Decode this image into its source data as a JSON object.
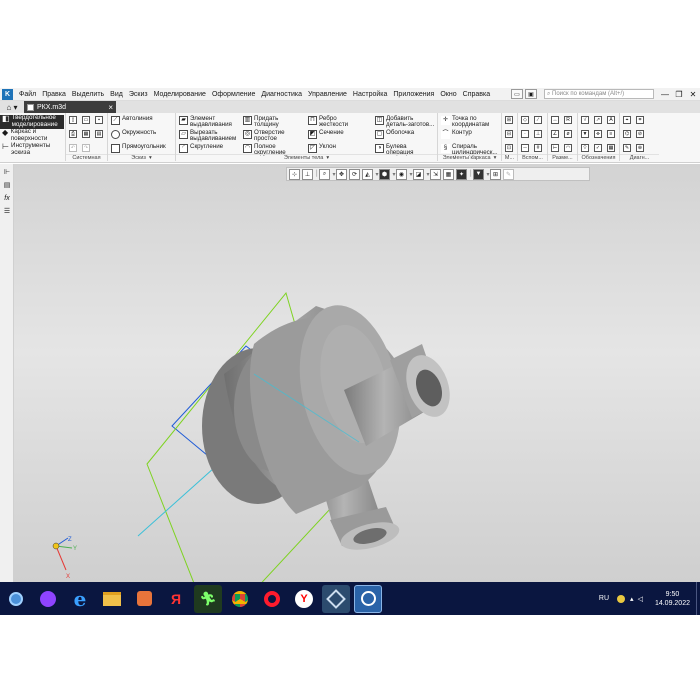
{
  "menubar": {
    "logo": "K",
    "items": [
      "Файл",
      "Правка",
      "Выделить",
      "Вид",
      "Эскиз",
      "Моделирование",
      "Оформление",
      "Диагностика",
      "Управление",
      "Настройка",
      "Приложения",
      "Окно",
      "Справка"
    ],
    "search_placeholder": "Поиск по командам (Alt+/)"
  },
  "tabs": {
    "home_icon": "home-icon",
    "document": "РКХ.m3d",
    "close": "×"
  },
  "ribbon": {
    "modes": [
      "Твердотельное моделирование",
      "Каркас и поверхности",
      "Инструменты эскиза"
    ],
    "groups": {
      "system": "Системная",
      "sketch": "Эскиз",
      "body": "Элементы тела",
      "frame": "Элементы каркаса",
      "m": "М...",
      "aux": "Вспом...",
      "size": "Разме...",
      "marks": "Обозначения",
      "diag": "Диагн..."
    },
    "sketch_tools": [
      "Автолиния",
      "Окружность",
      "Прямоугольник"
    ],
    "body_tools": [
      "Элемент выдавливания",
      "Вырезать выдавливанием",
      "Скругление",
      "Придать толщину",
      "Отверстие простое",
      "Полное скругление",
      "Ребро жесткости",
      "Сечение",
      "Уклон",
      "Добавить деталь-заготов...",
      "Оболочка",
      "Булева операция"
    ],
    "frame_tools": [
      "Точка по координатам",
      "Контур",
      "Спираль цилиндрическ..."
    ]
  },
  "viewport": {
    "background": "#d8d8d8",
    "model_color": "#8f8f8f",
    "plane_colors": [
      "#1f5bd6",
      "#7ed321",
      "#3cc0d8"
    ]
  },
  "axes": {
    "z": "Z",
    "x": "X",
    "y": "Y"
  },
  "taskbar": {
    "icons": [
      "windows-start-icon",
      "alice-icon",
      "edge-icon",
      "explorer-icon",
      "media-icon",
      "yandex-icon",
      "runner-icon",
      "chrome-icon",
      "opera-icon",
      "yandex-browser-icon",
      "kompas-icon",
      "kompas-3d-icon"
    ],
    "lang": "RU",
    "time": "9:50",
    "date": "14.09.2022"
  }
}
